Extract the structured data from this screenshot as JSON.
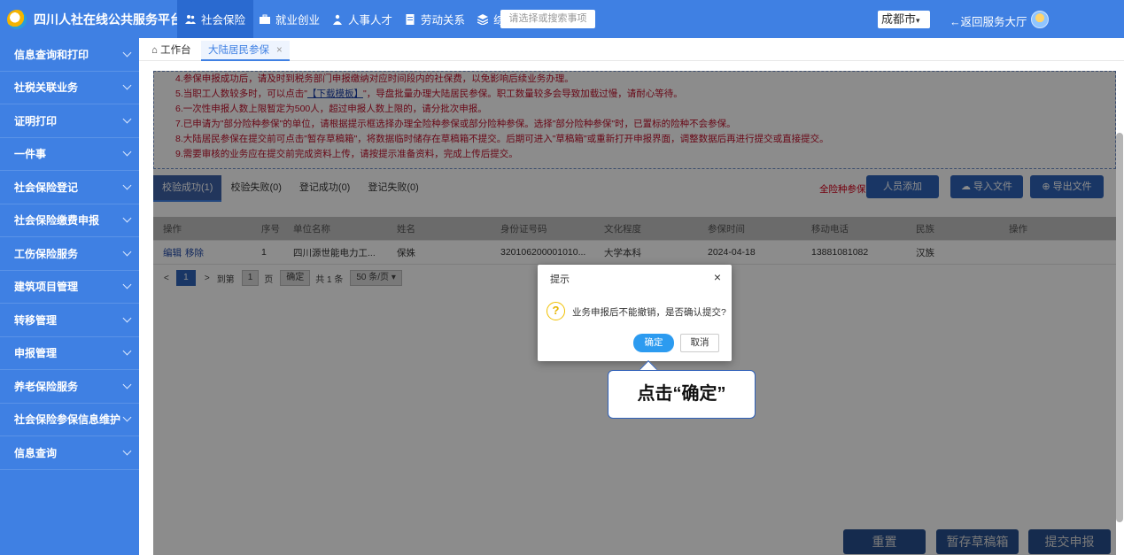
{
  "header": {
    "title": "四川人社在线公共服务平台",
    "nav": [
      "社会保险",
      "就业创业",
      "人事人才",
      "劳动关系",
      "综合"
    ],
    "search_placeholder": "请选择或搜索事项",
    "city": "成都市",
    "back_hall": "←返回服务大厅"
  },
  "sidebar": {
    "items": [
      "信息查询和打印",
      "社税关联业务",
      "证明打印",
      "一件事",
      "社会保险登记",
      "社会保险缴费申报",
      "工伤保险服务",
      "建筑项目管理",
      "转移管理",
      "申报管理",
      "养老保险服务",
      "社会保险参保信息维护",
      "信息查询"
    ]
  },
  "tabs": {
    "home": "工作台",
    "current": "大陆居民参保",
    "close": "×"
  },
  "notice": {
    "line4": "4.参保申报成功后，请及时到税务部门申报缴纳对应时间段内的社保费，以免影响后续业务办理。",
    "line5_pre": "5.当职工人数较多时，可以点击\"",
    "line5_link": "【下载模板】",
    "line5_post": "\"，导盘批量办理大陆居民参保。职工数量较多会导致加载过慢，请耐心等待。",
    "line6": "6.一次性申报人数上限暂定为500人，超过申报人数上限的，请分批次申报。",
    "line7": "7.已申请为\"部分险种参保\"的单位，请根据提示框选择办理全险种参保或部分险种参保。选择\"部分险种参保\"时，已置标的险种不会参保。",
    "line8": "8.大陆居民参保在提交前可点击\"暂存草稿箱\"，将数据临时储存在草稿箱不提交。后期可进入\"草稿箱\"或重新打开申报界面，调整数据后再进行提交或直接提交。",
    "line9": "9.需要审核的业务应在提交前完成资料上传，请按提示准备资料，完成上传后提交。"
  },
  "result_tabs": [
    "校验成功(1)",
    "校验失败(0)",
    "登记成功(0)",
    "登记失败(0)"
  ],
  "actions": {
    "full_label": "全险种参保",
    "add": "人员添加",
    "import": "导入文件",
    "export": "导出文件"
  },
  "table": {
    "headers": [
      "操作",
      "序号",
      "单位名称",
      "姓名",
      "身份证号码",
      "文化程度",
      "参保时间",
      "移动电话",
      "民族",
      "操作"
    ],
    "row": {
      "edit": "编辑",
      "remove": "移除",
      "index": "1",
      "company": "四川源世能电力工...",
      "name": "保姝",
      "id_no": "320106200001010...",
      "education": "大学本科",
      "date": "2024-04-18",
      "phone": "13881081082",
      "ethnicity": "汉族",
      "op": ""
    }
  },
  "pager": {
    "prev": "<",
    "current": "1",
    "next": ">",
    "goto": "到第",
    "page_input": "1",
    "page_unit": "页",
    "confirm": "确定",
    "total": "共 1 条",
    "page_size": "50 条/页"
  },
  "bottom_buttons": {
    "reset": "重置",
    "draft": "暂存草稿箱",
    "submit": "提交申报"
  },
  "dialog": {
    "title": "提示",
    "close": "×",
    "icon": "?",
    "message": "业务申报后不能撤销，是否确认提交?",
    "ok": "确定",
    "cancel": "取消"
  },
  "callout": {
    "text": "点击“确定”"
  },
  "colors": {
    "primary": "#3f80e3",
    "notice_red": "#c0102a",
    "dialog_ok": "#2c9bf0"
  }
}
